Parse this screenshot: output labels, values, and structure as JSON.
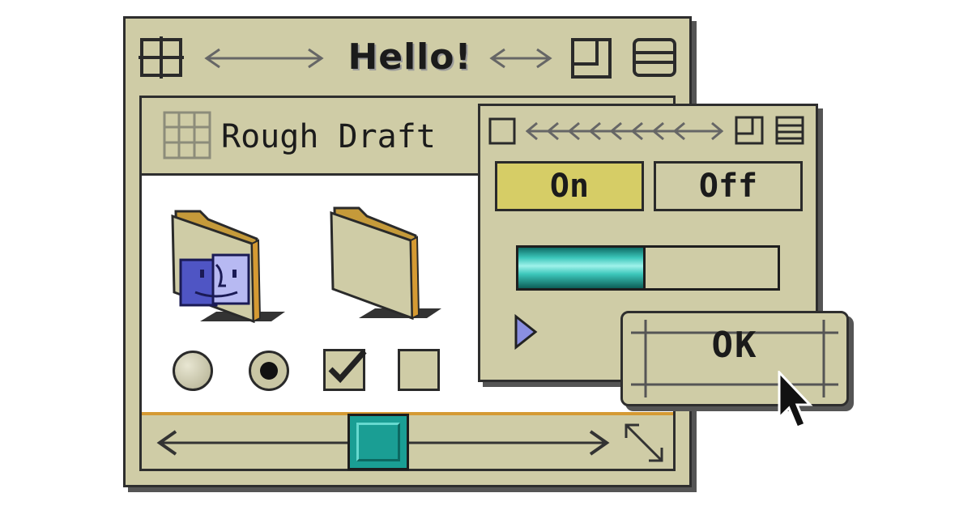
{
  "main_window": {
    "title": "Hello!",
    "icons": [
      "close-box-icon",
      "zoom-box-icon",
      "collapse-box-icon"
    ]
  },
  "document_window": {
    "title": "Rough Draft",
    "icons": [
      "grid-window-icon",
      "finder-folder-icon",
      "folder-icon",
      "resize-handle-icon"
    ],
    "controls": {
      "radio_1_selected": false,
      "radio_2_selected": true,
      "checkbox_1_checked": true,
      "checkbox_2_checked": false
    },
    "scrollbar_position": 0.38
  },
  "control_panel": {
    "on_label": "On",
    "off_label": "Off",
    "selected": "On",
    "progress": 0.49
  },
  "dialog": {
    "ok_label": "OK"
  },
  "colors": {
    "window_bg": "#cfcca6",
    "accent_teal": "#1a9e94",
    "selected_yellow": "#d6cd66",
    "scroll_orange": "#d59a33"
  }
}
